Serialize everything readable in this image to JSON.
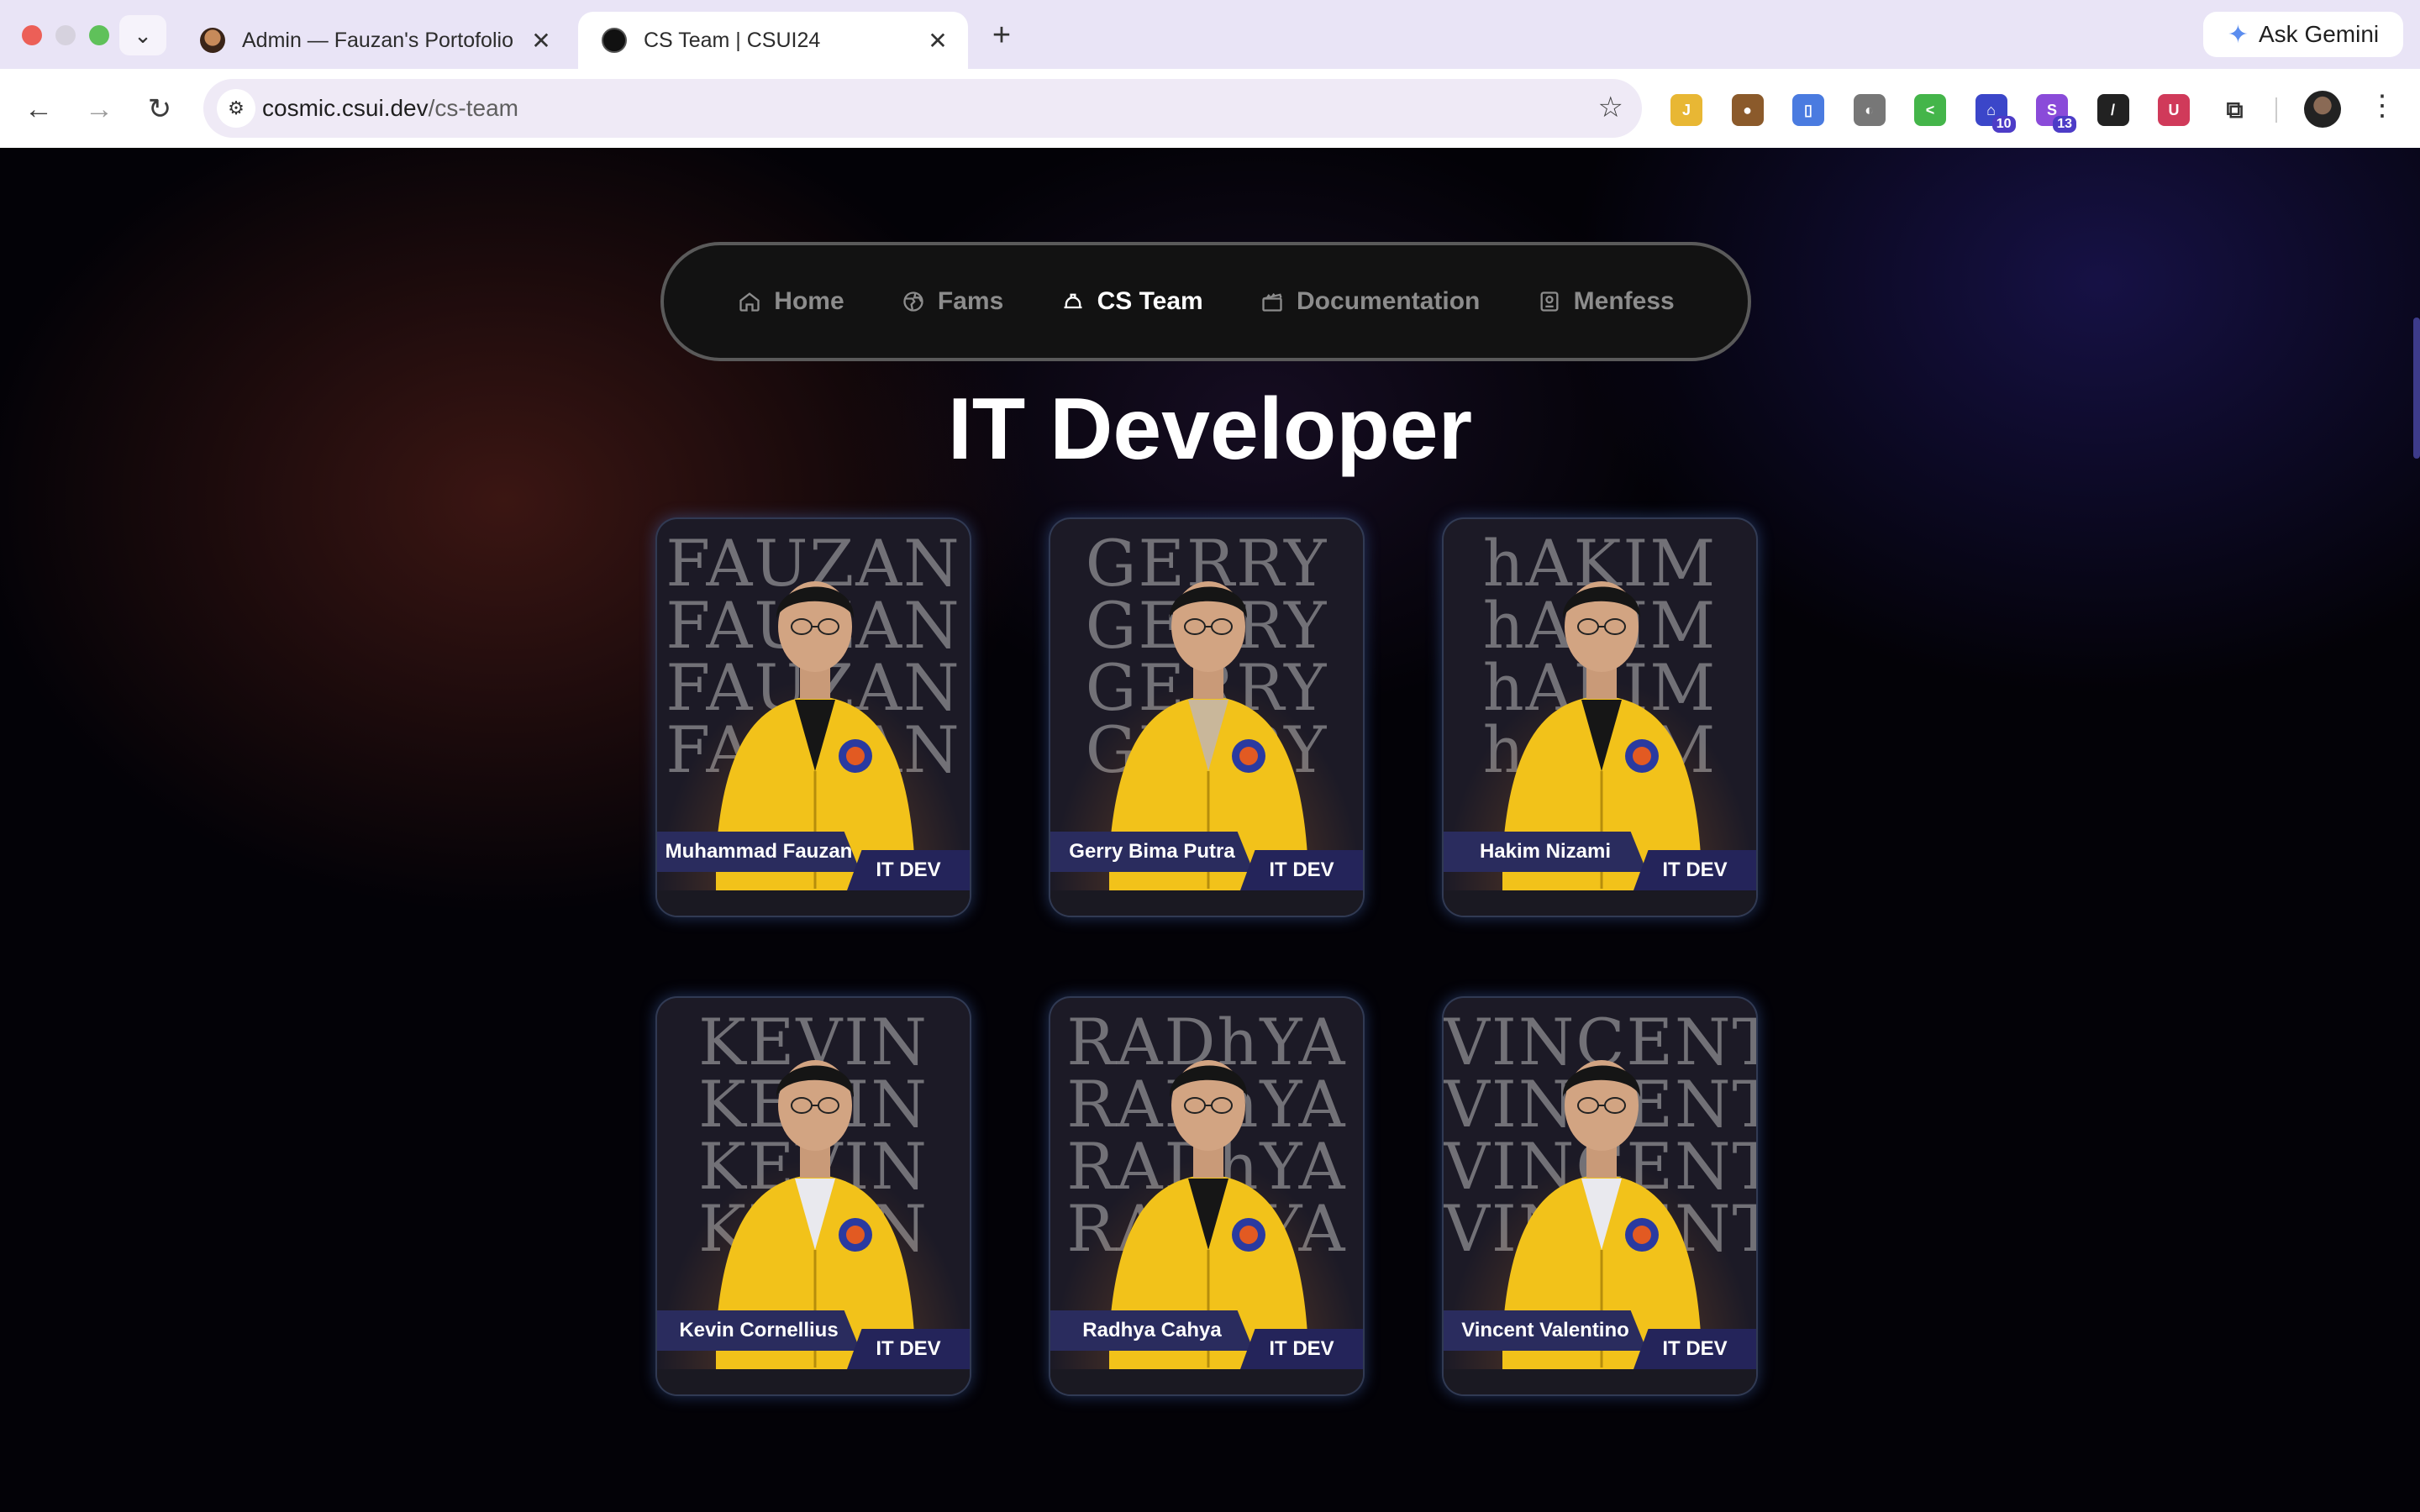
{
  "browser": {
    "tabs": [
      {
        "title": "Admin — Fauzan's Portofolio",
        "close": "✕"
      },
      {
        "title": "CS Team | CSUI24",
        "close": "✕"
      }
    ],
    "new_tab": "+",
    "tab_menu": "⌄",
    "gemini_label": "Ask Gemini",
    "url_host": "cosmic.csui.dev",
    "url_path": "/cs-team",
    "extensions": [
      {
        "name": "ext-1",
        "color": "#e8b734",
        "label": "J",
        "badge": ""
      },
      {
        "name": "cookie",
        "color": "#8b5a2b",
        "label": "●",
        "badge": ""
      },
      {
        "name": "ext-3",
        "color": "#4a7be0",
        "label": "▯",
        "badge": ""
      },
      {
        "name": "ext-4",
        "color": "#777777",
        "label": "◐",
        "badge": ""
      },
      {
        "name": "ext-5",
        "color": "#44b54a",
        "label": "<",
        "badge": ""
      },
      {
        "name": "ext-6",
        "color": "#3b46c9",
        "label": "⌂",
        "badge": "10"
      },
      {
        "name": "ext-7",
        "color": "#8a4bd9",
        "label": "S",
        "badge": "13"
      },
      {
        "name": "ext-8",
        "color": "#222222",
        "label": "/",
        "badge": ""
      },
      {
        "name": "ext-9",
        "color": "#d03a5a",
        "label": "U",
        "badge": ""
      },
      {
        "name": "puzzle",
        "color": "#ffffff",
        "label": "⧉",
        "badge": ""
      }
    ]
  },
  "nav": {
    "items": [
      {
        "label": "Home",
        "icon": "home-icon"
      },
      {
        "label": "Fams",
        "icon": "globe-icon"
      },
      {
        "label": "CS Team",
        "icon": "helmet-icon"
      },
      {
        "label": "Documentation",
        "icon": "clapper-icon"
      },
      {
        "label": "Menfess",
        "icon": "contact-icon"
      }
    ],
    "active": "CS Team"
  },
  "section_title": "IT Developer",
  "members": [
    {
      "name": "Muhammad Fauzan",
      "role": "IT DEV",
      "bg_word": "FAUZAN",
      "shirt": "black"
    },
    {
      "name": "Gerry Bima Putra",
      "role": "IT DEV",
      "bg_word": "GERRY",
      "shirt": "beige"
    },
    {
      "name": "Hakim Nizami",
      "role": "IT DEV",
      "bg_word": "hAKIM",
      "shirt": "black"
    },
    {
      "name": "Kevin Cornellius",
      "role": "IT DEV",
      "bg_word": "KEVIN",
      "shirt": "white"
    },
    {
      "name": "Radhya Cahya",
      "role": "IT DEV",
      "bg_word": "RADhYA",
      "shirt": "black"
    },
    {
      "name": "Vincent Valentino",
      "role": "IT DEV",
      "bg_word": "VINCENT",
      "shirt": "white"
    }
  ],
  "colors": {
    "jacket": "#f2c21a",
    "ribbon": "#2a2c5e"
  }
}
